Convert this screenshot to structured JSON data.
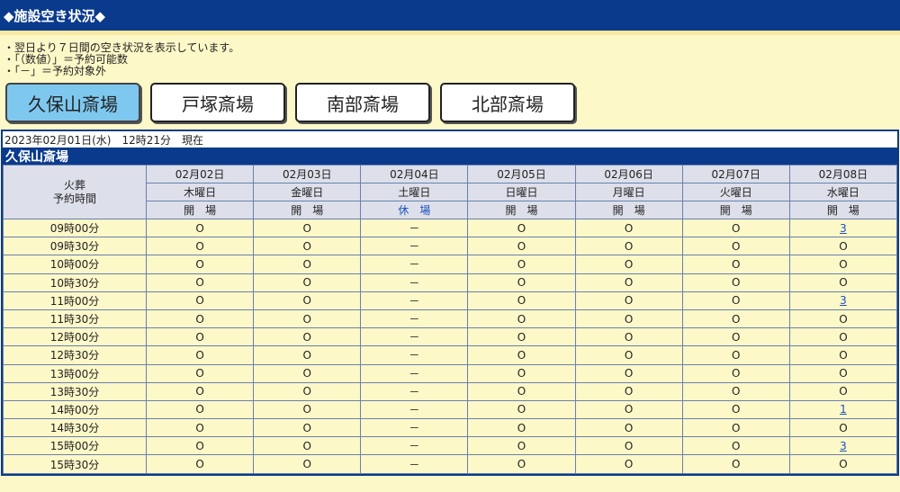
{
  "header": {
    "title": "◆施設空き状況◆"
  },
  "notes": [
    "・翌日より７日間の空き状況を表示しています。",
    "・「（数値）」＝予約可能数",
    "・「－」＝予約対象外"
  ],
  "tabs": [
    {
      "label": "久保山斎場",
      "active": true
    },
    {
      "label": "戸塚斎場",
      "active": false
    },
    {
      "label": "南部斎場",
      "active": false
    },
    {
      "label": "北部斎場",
      "active": false
    }
  ],
  "current_datetime": "2023年02月01日(水)　12時21分　現在",
  "facility_name": "久保山斎場",
  "table": {
    "corner_label_line1": "火葬",
    "corner_label_line2": "予約時間",
    "days": [
      {
        "date": "02月02日",
        "weekday": "木曜日",
        "status": "開　場",
        "closed": false
      },
      {
        "date": "02月03日",
        "weekday": "金曜日",
        "status": "開　場",
        "closed": false
      },
      {
        "date": "02月04日",
        "weekday": "土曜日",
        "status": "休　場",
        "closed": true
      },
      {
        "date": "02月05日",
        "weekday": "日曜日",
        "status": "開　場",
        "closed": false
      },
      {
        "date": "02月06日",
        "weekday": "月曜日",
        "status": "開　場",
        "closed": false
      },
      {
        "date": "02月07日",
        "weekday": "火曜日",
        "status": "開　場",
        "closed": false
      },
      {
        "date": "02月08日",
        "weekday": "水曜日",
        "status": "開　場",
        "closed": false
      }
    ],
    "rows": [
      {
        "time": "09時00分",
        "cells": [
          "O",
          "O",
          "－",
          "O",
          "O",
          "O",
          "3"
        ]
      },
      {
        "time": "09時30分",
        "cells": [
          "O",
          "O",
          "－",
          "O",
          "O",
          "O",
          "O"
        ]
      },
      {
        "time": "10時00分",
        "cells": [
          "O",
          "O",
          "－",
          "O",
          "O",
          "O",
          "O"
        ]
      },
      {
        "time": "10時30分",
        "cells": [
          "O",
          "O",
          "－",
          "O",
          "O",
          "O",
          "O"
        ]
      },
      {
        "time": "11時00分",
        "cells": [
          "O",
          "O",
          "－",
          "O",
          "O",
          "O",
          "3"
        ]
      },
      {
        "time": "11時30分",
        "cells": [
          "O",
          "O",
          "－",
          "O",
          "O",
          "O",
          "O"
        ]
      },
      {
        "time": "12時00分",
        "cells": [
          "O",
          "O",
          "－",
          "O",
          "O",
          "O",
          "O"
        ]
      },
      {
        "time": "12時30分",
        "cells": [
          "O",
          "O",
          "－",
          "O",
          "O",
          "O",
          "O"
        ]
      },
      {
        "time": "13時00分",
        "cells": [
          "O",
          "O",
          "－",
          "O",
          "O",
          "O",
          "O"
        ]
      },
      {
        "time": "13時30分",
        "cells": [
          "O",
          "O",
          "－",
          "O",
          "O",
          "O",
          "O"
        ]
      },
      {
        "time": "14時00分",
        "cells": [
          "O",
          "O",
          "－",
          "O",
          "O",
          "O",
          "1"
        ]
      },
      {
        "time": "14時30分",
        "cells": [
          "O",
          "O",
          "－",
          "O",
          "O",
          "O",
          "O"
        ]
      },
      {
        "time": "15時00分",
        "cells": [
          "O",
          "O",
          "－",
          "O",
          "O",
          "O",
          "3"
        ]
      },
      {
        "time": "15時30分",
        "cells": [
          "O",
          "O",
          "－",
          "O",
          "O",
          "O",
          "O"
        ]
      }
    ]
  }
}
